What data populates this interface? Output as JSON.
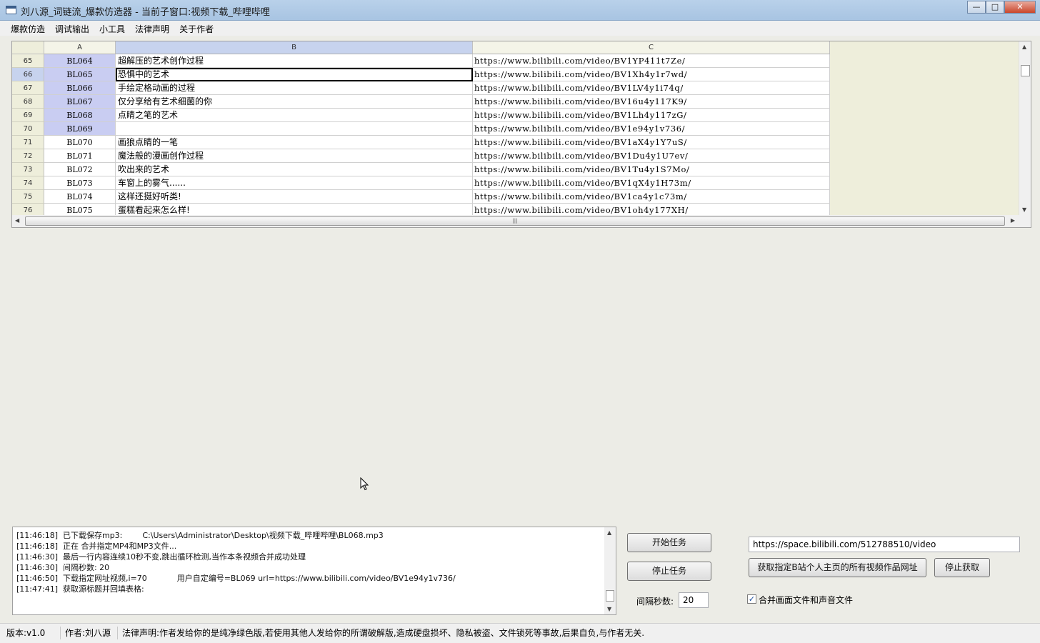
{
  "window": {
    "title": "刘八源_词链流_爆款仿造器 - 当前子窗口:视频下载_哔哩哔哩",
    "minimize": "—",
    "maximize": "□",
    "close": "✕"
  },
  "menu": [
    "爆款仿造",
    "调试输出",
    "小工具",
    "法律声明",
    "关于作者"
  ],
  "grid": {
    "columns": [
      "A",
      "B",
      "C"
    ],
    "rows": [
      {
        "num": "65",
        "a": "BL064",
        "b": "超解压的艺术创作过程",
        "c": "https://www.bilibili.com/video/BV1YP411t7Ze/"
      },
      {
        "num": "66",
        "a": "BL065",
        "b": "恐惧中的艺术",
        "c": "https://www.bilibili.com/video/BV1Xh4y1r7wd/"
      },
      {
        "num": "67",
        "a": "BL066",
        "b": "手绘定格动画的过程",
        "c": "https://www.bilibili.com/video/BV1LV4y1i74q/"
      },
      {
        "num": "68",
        "a": "BL067",
        "b": "仅分享给有艺术细菌的你",
        "c": "https://www.bilibili.com/video/BV16u4y117K9/"
      },
      {
        "num": "69",
        "a": "BL068",
        "b": "点睛之笔的艺术",
        "c": "https://www.bilibili.com/video/BV1Lh4y117zG/"
      },
      {
        "num": "70",
        "a": "BL069",
        "b": "",
        "c": "https://www.bilibili.com/video/BV1e94y1v736/"
      },
      {
        "num": "71",
        "a": "BL070",
        "b": "画狼点睛的一笔",
        "c": "https://www.bilibili.com/video/BV1aX4y1Y7uS/"
      },
      {
        "num": "72",
        "a": "BL071",
        "b": "魔法般的漫画创作过程",
        "c": "https://www.bilibili.com/video/BV1Du4y1U7ev/"
      },
      {
        "num": "73",
        "a": "BL072",
        "b": "吹出来的艺术",
        "c": "https://www.bilibili.com/video/BV1Tu4y1S7Mo/"
      },
      {
        "num": "74",
        "a": "BL073",
        "b": "车窗上的雾气......",
        "c": "https://www.bilibili.com/video/BV1qX4y1H73m/"
      },
      {
        "num": "75",
        "a": "BL074",
        "b": "这样还挺好听类!",
        "c": "https://www.bilibili.com/video/BV1ca4y1c73m/"
      },
      {
        "num": "76",
        "a": "BL075",
        "b": "蛋糕看起来怎么样!",
        "c": "https://www.bilibili.com/video/BV1oh4y177XH/"
      }
    ]
  },
  "log": [
    "[11:46:18]  已下载保存mp3:        C:\\Users\\Administrator\\Desktop\\视频下载_哔哩哔哩\\BL068.mp3",
    "[11:46:18]  正在 合并指定MP4和MP3文件...",
    "[11:46:30]  最后一行内容连续10秒不变,跳出循环检测,当作本条视频合并成功处理",
    "[11:46:30]  间隔秒数: 20",
    "[11:46:50]  下载指定网址视频,i=70            用户自定编号=BL069 url=https://www.bilibili.com/video/BV1e94y1v736/",
    "[11:47:41]  获取源标题并回填表格:"
  ],
  "controls": {
    "start_task": "开始任务",
    "stop_task": "停止任务",
    "interval_label": "间隔秒数:",
    "interval_value": "20",
    "url_value": "https://space.bilibili.com/512788510/video",
    "fetch_button": "获取指定B站个人主页的所有视频作品网址",
    "stop_fetch": "停止获取",
    "merge_label": "合并画面文件和声音文件",
    "merge_checked": true
  },
  "status": {
    "version": "版本:v1.0",
    "author": "作者:刘八源",
    "legal": "法律声明:作者发给你的是纯净绿色版,若使用其他人发给你的所谓破解版,造成硬盘损坏、隐私被盗、文件锁死等事故,后果自负,与作者无关."
  }
}
